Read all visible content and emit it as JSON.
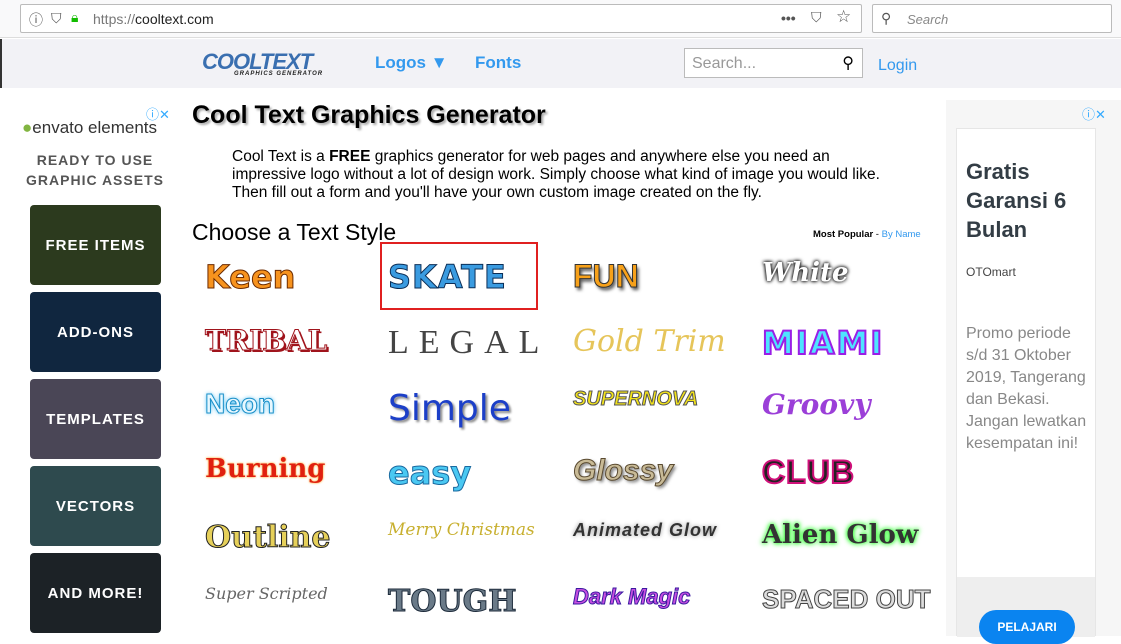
{
  "browser": {
    "url_prefix": "https://",
    "url_host": "cooltext.com",
    "search_placeholder": "Search"
  },
  "nav": {
    "logo": "COOLTEXT",
    "logo_sub": "GRAPHICS GENERATOR",
    "logos": "Logos ▼",
    "fonts": "Fonts",
    "search_placeholder": "Search...",
    "login": "Login"
  },
  "left_ad": {
    "brand": "envato elements",
    "headline": "READY TO USE GRAPHIC ASSETS",
    "tiles": [
      "FREE ITEMS",
      "ADD-ONS",
      "TEMPLATES",
      "VECTORS",
      "AND MORE!"
    ]
  },
  "main": {
    "title": "Cool Text Graphics Generator",
    "intro_pre": "Cool Text is a ",
    "intro_bold": "FREE",
    "intro_post": " graphics generator for web pages and anywhere else you need an impressive logo without a lot of design work. Simply choose what kind of image you would like. Then fill out a form and you'll have your own custom image created on the fly.",
    "section": "Choose a Text Style",
    "sort_popular": "Most Popular",
    "sort_sep": " - ",
    "sort_name": "By Name",
    "styles": [
      "Keen",
      "SKATE",
      "FUN",
      "White",
      "TRIBAL",
      "LEGAL",
      "Gold Trim",
      "MIAMI",
      "Neon",
      "Simple",
      "SUPERNOVA",
      "Groovy",
      "Burning",
      "easy",
      "Glossy",
      "CLUB",
      "Outline",
      "Merry Christmas",
      "Animated Glow",
      "Alien Glow",
      "Super Scripted",
      "TOUGH",
      "Dark Magic",
      "SPACED OUT"
    ]
  },
  "right_ad": {
    "title": "Gratis Garansi 6 Bulan",
    "advertiser": "OTOmart",
    "body": "Promo periode s/d 31 Oktober 2019, Tangerang dan Bekasi. Jangan lewatkan kesempatan ini!",
    "cta": "PELAJARI"
  },
  "colors": {
    "link": "#3399ee",
    "selected_border": "#e02020",
    "cta": "#0a84f0"
  }
}
